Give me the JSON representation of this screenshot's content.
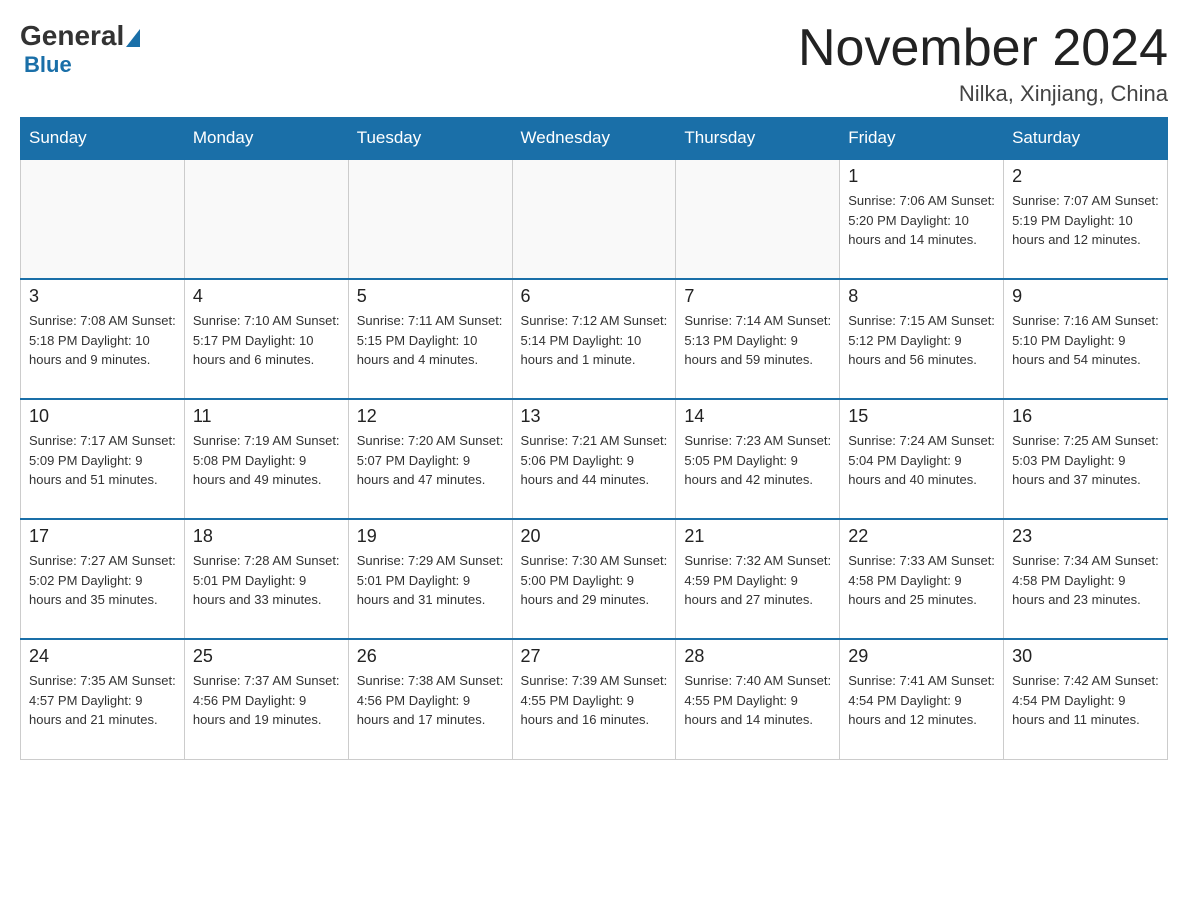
{
  "header": {
    "logo": {
      "general": "General",
      "blue": "Blue"
    },
    "title": "November 2024",
    "location": "Nilka, Xinjiang, China"
  },
  "days_of_week": [
    "Sunday",
    "Monday",
    "Tuesday",
    "Wednesday",
    "Thursday",
    "Friday",
    "Saturday"
  ],
  "weeks": [
    [
      {
        "day": "",
        "info": ""
      },
      {
        "day": "",
        "info": ""
      },
      {
        "day": "",
        "info": ""
      },
      {
        "day": "",
        "info": ""
      },
      {
        "day": "",
        "info": ""
      },
      {
        "day": "1",
        "info": "Sunrise: 7:06 AM\nSunset: 5:20 PM\nDaylight: 10 hours and 14 minutes."
      },
      {
        "day": "2",
        "info": "Sunrise: 7:07 AM\nSunset: 5:19 PM\nDaylight: 10 hours and 12 minutes."
      }
    ],
    [
      {
        "day": "3",
        "info": "Sunrise: 7:08 AM\nSunset: 5:18 PM\nDaylight: 10 hours and 9 minutes."
      },
      {
        "day": "4",
        "info": "Sunrise: 7:10 AM\nSunset: 5:17 PM\nDaylight: 10 hours and 6 minutes."
      },
      {
        "day": "5",
        "info": "Sunrise: 7:11 AM\nSunset: 5:15 PM\nDaylight: 10 hours and 4 minutes."
      },
      {
        "day": "6",
        "info": "Sunrise: 7:12 AM\nSunset: 5:14 PM\nDaylight: 10 hours and 1 minute."
      },
      {
        "day": "7",
        "info": "Sunrise: 7:14 AM\nSunset: 5:13 PM\nDaylight: 9 hours and 59 minutes."
      },
      {
        "day": "8",
        "info": "Sunrise: 7:15 AM\nSunset: 5:12 PM\nDaylight: 9 hours and 56 minutes."
      },
      {
        "day": "9",
        "info": "Sunrise: 7:16 AM\nSunset: 5:10 PM\nDaylight: 9 hours and 54 minutes."
      }
    ],
    [
      {
        "day": "10",
        "info": "Sunrise: 7:17 AM\nSunset: 5:09 PM\nDaylight: 9 hours and 51 minutes."
      },
      {
        "day": "11",
        "info": "Sunrise: 7:19 AM\nSunset: 5:08 PM\nDaylight: 9 hours and 49 minutes."
      },
      {
        "day": "12",
        "info": "Sunrise: 7:20 AM\nSunset: 5:07 PM\nDaylight: 9 hours and 47 minutes."
      },
      {
        "day": "13",
        "info": "Sunrise: 7:21 AM\nSunset: 5:06 PM\nDaylight: 9 hours and 44 minutes."
      },
      {
        "day": "14",
        "info": "Sunrise: 7:23 AM\nSunset: 5:05 PM\nDaylight: 9 hours and 42 minutes."
      },
      {
        "day": "15",
        "info": "Sunrise: 7:24 AM\nSunset: 5:04 PM\nDaylight: 9 hours and 40 minutes."
      },
      {
        "day": "16",
        "info": "Sunrise: 7:25 AM\nSunset: 5:03 PM\nDaylight: 9 hours and 37 minutes."
      }
    ],
    [
      {
        "day": "17",
        "info": "Sunrise: 7:27 AM\nSunset: 5:02 PM\nDaylight: 9 hours and 35 minutes."
      },
      {
        "day": "18",
        "info": "Sunrise: 7:28 AM\nSunset: 5:01 PM\nDaylight: 9 hours and 33 minutes."
      },
      {
        "day": "19",
        "info": "Sunrise: 7:29 AM\nSunset: 5:01 PM\nDaylight: 9 hours and 31 minutes."
      },
      {
        "day": "20",
        "info": "Sunrise: 7:30 AM\nSunset: 5:00 PM\nDaylight: 9 hours and 29 minutes."
      },
      {
        "day": "21",
        "info": "Sunrise: 7:32 AM\nSunset: 4:59 PM\nDaylight: 9 hours and 27 minutes."
      },
      {
        "day": "22",
        "info": "Sunrise: 7:33 AM\nSunset: 4:58 PM\nDaylight: 9 hours and 25 minutes."
      },
      {
        "day": "23",
        "info": "Sunrise: 7:34 AM\nSunset: 4:58 PM\nDaylight: 9 hours and 23 minutes."
      }
    ],
    [
      {
        "day": "24",
        "info": "Sunrise: 7:35 AM\nSunset: 4:57 PM\nDaylight: 9 hours and 21 minutes."
      },
      {
        "day": "25",
        "info": "Sunrise: 7:37 AM\nSunset: 4:56 PM\nDaylight: 9 hours and 19 minutes."
      },
      {
        "day": "26",
        "info": "Sunrise: 7:38 AM\nSunset: 4:56 PM\nDaylight: 9 hours and 17 minutes."
      },
      {
        "day": "27",
        "info": "Sunrise: 7:39 AM\nSunset: 4:55 PM\nDaylight: 9 hours and 16 minutes."
      },
      {
        "day": "28",
        "info": "Sunrise: 7:40 AM\nSunset: 4:55 PM\nDaylight: 9 hours and 14 minutes."
      },
      {
        "day": "29",
        "info": "Sunrise: 7:41 AM\nSunset: 4:54 PM\nDaylight: 9 hours and 12 minutes."
      },
      {
        "day": "30",
        "info": "Sunrise: 7:42 AM\nSunset: 4:54 PM\nDaylight: 9 hours and 11 minutes."
      }
    ]
  ]
}
